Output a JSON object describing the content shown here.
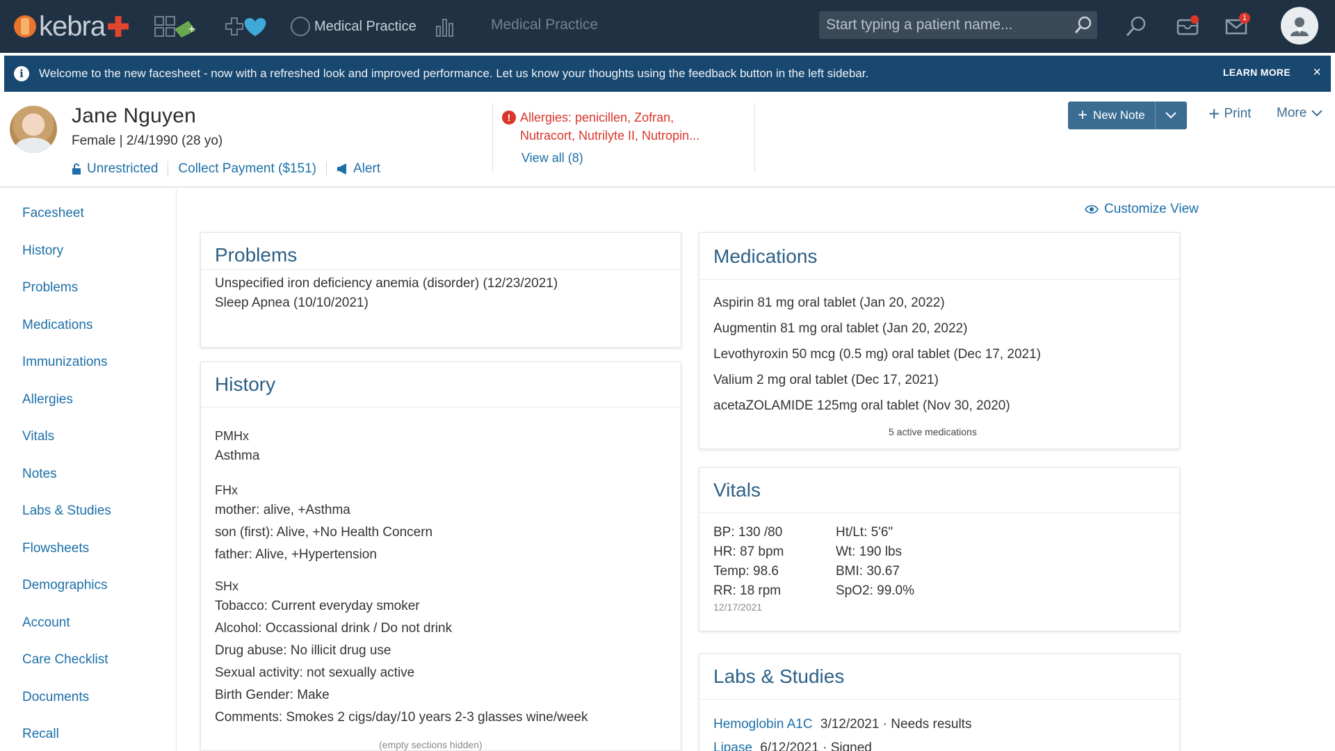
{
  "app": {
    "logo_text": "kebra",
    "nav_practice_label": "Medical Practice",
    "nav_title": "Medical Practice"
  },
  "search": {
    "placeholder": "Start typing a patient name..."
  },
  "notifications": {
    "mail_count": "1"
  },
  "banner": {
    "message": "Welcome to the new facesheet - now with a refreshed look and improved performance. Let us know your thoughts using the feedback button in the left sidebar.",
    "learn_more": "LEARN MORE",
    "close": "×"
  },
  "patient": {
    "name": "Jane Nguyen",
    "demographics": "Female | 2/4/1990 (28 yo)",
    "restricted_label": "Unrestricted",
    "collect_payment_label": "Collect Payment ($151)",
    "alert_label": "Alert",
    "allergies_text": "Allergies: penicillen, Zofran, Nutracort, Nutrilyte II, Nutropin...",
    "allergies_view_all": "View all (8)"
  },
  "actions": {
    "new_note": "New Note",
    "print": "Print",
    "more": "More"
  },
  "sidebar": {
    "items": [
      {
        "label": "Facesheet"
      },
      {
        "label": "History"
      },
      {
        "label": "Problems"
      },
      {
        "label": "Medications"
      },
      {
        "label": "Immunizations"
      },
      {
        "label": "Allergies"
      },
      {
        "label": "Vitals"
      },
      {
        "label": "Notes"
      },
      {
        "label": "Labs & Studies"
      },
      {
        "label": "Flowsheets"
      },
      {
        "label": "Demographics"
      },
      {
        "label": "Account"
      },
      {
        "label": "Care Checklist"
      },
      {
        "label": "Documents"
      },
      {
        "label": "Recall"
      }
    ]
  },
  "main": {
    "customize_view": "Customize View"
  },
  "problems": {
    "title": "Problems",
    "items": [
      "Unspecified iron deficiency anemia (disorder) (12/23/2021)",
      "Sleep Apnea (10/10/2021)"
    ]
  },
  "history": {
    "title": "History",
    "pmhx_label": "PMHx",
    "pmhx_items": [
      "Asthma"
    ],
    "fhx_label": "FHx",
    "fhx_items": [
      "mother: alive, +Asthma",
      "son (first): Alive, +No Health Concern",
      "father: Alive, +Hypertension"
    ],
    "shx_label": "SHx",
    "shx_items": [
      "Tobacco: Current everyday smoker",
      "Alcohol: Occassional drink / Do not drink",
      "Drug abuse: No illicit drug use",
      "Sexual activity: not sexually active",
      "Birth Gender: Make",
      "Comments: Smokes 2 cigs/day/10 years 2-3 glasses wine/week"
    ],
    "footer": "(empty sections hidden)"
  },
  "medications": {
    "title": "Medications",
    "items": [
      "Aspirin 81 mg oral tablet (Jan 20, 2022)",
      "Augmentin 81 mg oral tablet (Jan 20, 2022)",
      "Levothyroxin 50 mcg (0.5 mg) oral tablet (Dec 17, 2021)",
      "Valium 2 mg oral tablet (Dec 17, 2021)",
      "acetaZOLAMIDE 125mg oral tablet (Nov 30, 2020)"
    ],
    "footer": "5 active medications"
  },
  "vitals": {
    "title": "Vitals",
    "left": [
      "BP: 130 /80",
      "HR: 87 bpm",
      "Temp: 98.6",
      "RR: 18 rpm"
    ],
    "right": [
      "Ht/Lt: 5'6\"",
      "Wt: 190 lbs",
      "BMI: 30.67",
      "SpO2: 99.0%"
    ],
    "date": "12/17/2021"
  },
  "labs": {
    "title": "Labs & Studies",
    "rows": [
      {
        "name": "Hemoglobin A1C",
        "detail": "3/12/2021 · Needs results"
      },
      {
        "name": "Lipase",
        "detail": "6/12/2021 · Signed"
      }
    ]
  },
  "colors": {
    "topbar": "#1f3142",
    "banner": "#18476f",
    "link": "#1b6fa8",
    "card_title": "#2c5f86",
    "allergy": "#d9362b",
    "primary_button": "#3b6d93"
  }
}
